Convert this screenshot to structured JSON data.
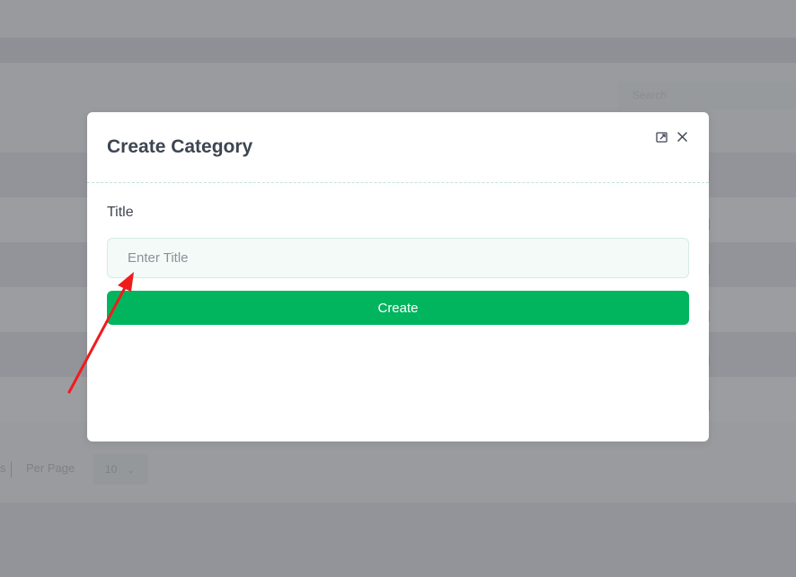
{
  "background": {
    "search_placeholder": "Search",
    "pagination": {
      "prev_fragment": "s",
      "per_page_label": "Per Page",
      "per_page_value": "10"
    }
  },
  "modal": {
    "title": "Create Category",
    "icons": [
      "expand-icon",
      "close-icon"
    ],
    "field_label": "Title",
    "input_value": "",
    "input_placeholder": "Enter Title",
    "submit_label": "Create"
  },
  "colors": {
    "accent": "#00b55e",
    "title_text": "#3d4552",
    "input_bg": "#f3faf7",
    "annotation_arrow": "#f01c1c"
  }
}
